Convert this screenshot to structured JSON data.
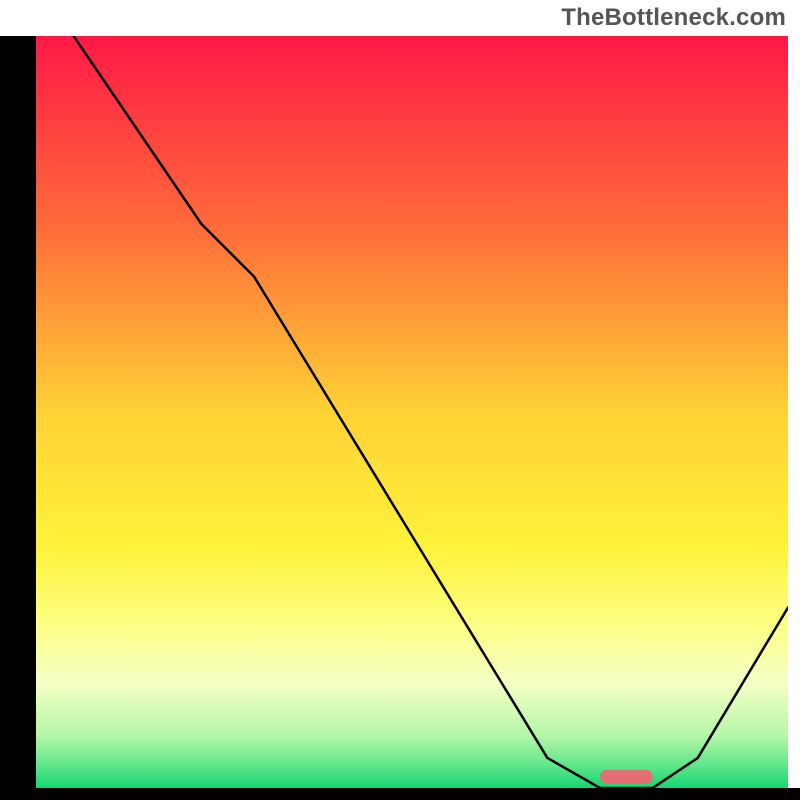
{
  "attribution": "TheBottleneck.com",
  "chart_data": {
    "type": "line",
    "title": "",
    "xlabel": "",
    "ylabel": "",
    "xlim": [
      0,
      100
    ],
    "ylim": [
      0,
      100
    ],
    "x": [
      0,
      5,
      22,
      29,
      68,
      75,
      82,
      88,
      100
    ],
    "values": [
      110,
      100,
      75,
      68,
      4,
      0,
      0,
      4,
      24
    ],
    "optimal_band": {
      "x_start": 75,
      "x_end": 82,
      "y": 1.5
    },
    "gradient_stops": [
      {
        "offset": 0.0,
        "color": "#ff1946"
      },
      {
        "offset": 0.25,
        "color": "#ff6a3a"
      },
      {
        "offset": 0.5,
        "color": "#ffd236"
      },
      {
        "offset": 0.68,
        "color": "#fff23a"
      },
      {
        "offset": 0.78,
        "color": "#fdff82"
      },
      {
        "offset": 0.86,
        "color": "#f5ffc5"
      },
      {
        "offset": 0.93,
        "color": "#b5f7a8"
      },
      {
        "offset": 0.97,
        "color": "#5fe68a"
      },
      {
        "offset": 1.0,
        "color": "#13d673"
      }
    ]
  },
  "geometry": {
    "outer": 800,
    "margin_left": 36,
    "margin_top": 36,
    "margin_right": 12,
    "margin_bottom": 12
  }
}
